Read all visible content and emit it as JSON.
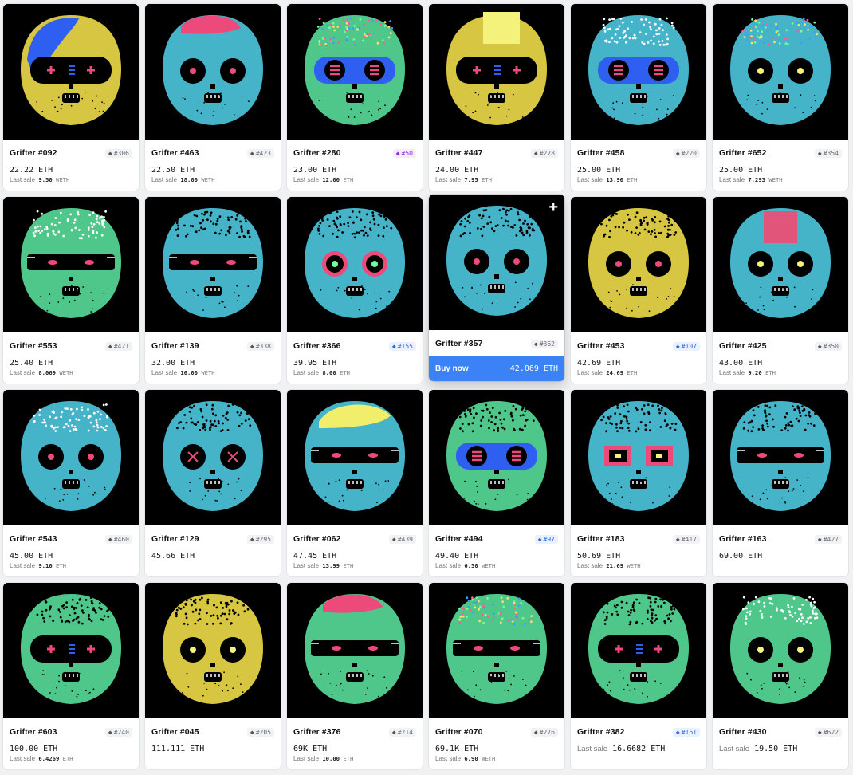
{
  "colors": {
    "yellow": "#d7c641",
    "cyan": "#45b3c8",
    "green": "#4fc78a",
    "pink": "#ec4a7a",
    "blue": "#2f5ff0",
    "buy_now_bg": "#3b82f6"
  },
  "cards": [
    {
      "name": "Grifter #092",
      "rank": "#306",
      "rank_color": "gray",
      "price": "22.22 ETH",
      "last_sale_label": "Last sale",
      "last_sale_value": "9.50",
      "last_sale_unit": "WETH",
      "skin": "yellow",
      "hair": "blue",
      "eyes": "glasses-cross"
    },
    {
      "name": "Grifter #463",
      "rank": "#423",
      "rank_color": "gray",
      "price": "22.50 ETH",
      "last_sale_label": "Last sale",
      "last_sale_value": "18.00",
      "last_sale_unit": "WETH",
      "skin": "cyan",
      "hair": "pink",
      "eyes": "round"
    },
    {
      "name": "Grifter #280",
      "rank": "#50",
      "rank_color": "purple",
      "price": "23.00 ETH",
      "last_sale_label": "Last sale",
      "last_sale_value": "12.00",
      "last_sale_unit": "ETH",
      "skin": "green",
      "hair": "dots",
      "eyes": "glasses-bars"
    },
    {
      "name": "Grifter #447",
      "rank": "#278",
      "rank_color": "gray",
      "price": "24.00 ETH",
      "last_sale_label": "Last sale",
      "last_sale_value": "7.95",
      "last_sale_unit": "ETH",
      "skin": "yellow",
      "hair": "yellowblock",
      "eyes": "glasses-cross"
    },
    {
      "name": "Grifter #458",
      "rank": "#220",
      "rank_color": "gray",
      "price": "25.00 ETH",
      "last_sale_label": "Last sale",
      "last_sale_value": "13.90",
      "last_sale_unit": "ETH",
      "skin": "cyan",
      "hair": "dots-white",
      "eyes": "glasses-bars"
    },
    {
      "name": "Grifter #652",
      "rank": "#354",
      "rank_color": "gray",
      "price": "25.00 ETH",
      "last_sale_label": "Last sale",
      "last_sale_value": "7.293",
      "last_sale_unit": "WETH",
      "skin": "cyan",
      "hair": "dots",
      "eyes": "round-yellow"
    },
    {
      "name": "Grifter #553",
      "rank": "#421",
      "rank_color": "gray",
      "price": "25.40 ETH",
      "last_sale_label": "Last sale",
      "last_sale_value": "8.069",
      "last_sale_unit": "WETH",
      "skin": "green",
      "hair": "dots-white",
      "eyes": "mask"
    },
    {
      "name": "Grifter #139",
      "rank": "#338",
      "rank_color": "gray",
      "price": "32.00 ETH",
      "last_sale_label": "Last sale",
      "last_sale_value": "16.00",
      "last_sale_unit": "WETH",
      "skin": "cyan",
      "hair": "dots-dark",
      "eyes": "mask"
    },
    {
      "name": "Grifter #366",
      "rank": "#155",
      "rank_color": "blue",
      "price": "39.95 ETH",
      "last_sale_label": "Last sale",
      "last_sale_value": "8.00",
      "last_sale_unit": "ETH",
      "skin": "cyan",
      "hair": "dots-dark",
      "eyes": "round-green"
    },
    {
      "name": "Grifter #357",
      "rank": "#362",
      "rank_color": "gray",
      "hover": true,
      "buy_label": "Buy now",
      "buy_price": "42.069 ETH",
      "skin": "cyan",
      "hair": "dots-dark",
      "eyes": "round"
    },
    {
      "name": "Grifter #453",
      "rank": "#107",
      "rank_color": "blue",
      "price": "42.69 ETH",
      "last_sale_label": "Last sale",
      "last_sale_value": "24.69",
      "last_sale_unit": "ETH",
      "skin": "yellow",
      "hair": "dots-dark",
      "eyes": "round"
    },
    {
      "name": "Grifter #425",
      "rank": "#350",
      "rank_color": "gray",
      "price": "43.00 ETH",
      "last_sale_label": "Last sale",
      "last_sale_value": "9.20",
      "last_sale_unit": "ETH",
      "skin": "cyan",
      "hair": "pinkblock",
      "eyes": "round-yellow"
    },
    {
      "name": "Grifter #543",
      "rank": "#460",
      "rank_color": "gray",
      "price": "45.00 ETH",
      "last_sale_label": "Last sale",
      "last_sale_value": "9.10",
      "last_sale_unit": "ETH",
      "skin": "cyan",
      "hair": "dots-white",
      "eyes": "round"
    },
    {
      "name": "Grifter #129",
      "rank": "#295",
      "rank_color": "gray",
      "price": "45.66 ETH",
      "skin": "cyan",
      "hair": "dots-dark",
      "eyes": "round-x"
    },
    {
      "name": "Grifter #062",
      "rank": "#439",
      "rank_color": "gray",
      "price": "47.45 ETH",
      "last_sale_label": "Last sale",
      "last_sale_value": "13.99",
      "last_sale_unit": "ETH",
      "skin": "cyan",
      "hair": "yellow",
      "eyes": "mask"
    },
    {
      "name": "Grifter #494",
      "rank": "#97",
      "rank_color": "blue",
      "price": "49.40 ETH",
      "last_sale_label": "Last sale",
      "last_sale_value": "6.50",
      "last_sale_unit": "WETH",
      "skin": "green",
      "hair": "dots-dark",
      "eyes": "glasses-bars"
    },
    {
      "name": "Grifter #183",
      "rank": "#417",
      "rank_color": "gray",
      "price": "50.69 ETH",
      "last_sale_label": "Last sale",
      "last_sale_value": "21.69",
      "last_sale_unit": "WETH",
      "skin": "cyan",
      "hair": "dots-dark",
      "eyes": "square"
    },
    {
      "name": "Grifter #163",
      "rank": "#427",
      "rank_color": "gray",
      "price": "69.00 ETH",
      "skin": "cyan",
      "hair": "dots-dark",
      "eyes": "mask"
    },
    {
      "name": "Grifter #603",
      "rank": "#240",
      "rank_color": "gray",
      "price": "100.00 ETH",
      "last_sale_label": "Last sale",
      "last_sale_value": "6.4269",
      "last_sale_unit": "ETH",
      "skin": "green",
      "hair": "dots-dark",
      "eyes": "glasses-cross"
    },
    {
      "name": "Grifter #045",
      "rank": "#205",
      "rank_color": "gray",
      "price": "111.111 ETH",
      "skin": "yellow",
      "hair": "dots-dark",
      "eyes": "round-yellow"
    },
    {
      "name": "Grifter #376",
      "rank": "#214",
      "rank_color": "gray",
      "price": "69K ETH",
      "last_sale_label": "Last sale",
      "last_sale_value": "10.00",
      "last_sale_unit": "ETH",
      "skin": "green",
      "hair": "pink",
      "eyes": "mask"
    },
    {
      "name": "Grifter #070",
      "rank": "#276",
      "rank_color": "gray",
      "price": "69.1K ETH",
      "last_sale_label": "Last sale",
      "last_sale_value": "6.90",
      "last_sale_unit": "WETH",
      "skin": "green",
      "hair": "dots",
      "eyes": "mask"
    },
    {
      "name": "Grifter #382",
      "rank": "#161",
      "rank_color": "blue",
      "price_label": "Last sale",
      "price": "16.6682 ETH",
      "skin": "green",
      "hair": "dots-dark",
      "eyes": "glasses-cross"
    },
    {
      "name": "Grifter #430",
      "rank": "#622",
      "rank_color": "gray",
      "price_label": "Last sale",
      "price": "19.50 ETH",
      "skin": "green",
      "hair": "dots-white",
      "eyes": "round-yellow"
    }
  ]
}
